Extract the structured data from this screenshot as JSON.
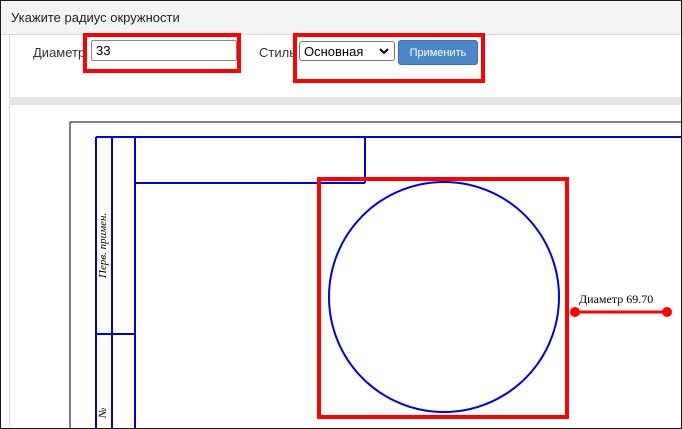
{
  "window": {
    "title": "Укажите радиус окружности"
  },
  "toolbar": {
    "diameter_label": "Диаметр",
    "diameter_value": "33",
    "style_label": "Стиль",
    "style_selected": "Основная",
    "apply_label": "Применить"
  },
  "drawing": {
    "stamp_vertical_text": "Перв. примен.",
    "stamp_number_mark": "№",
    "dimension_label": "Диаметр 69.70",
    "circle_color": "#0000dd",
    "highlight_color": "#ff0000"
  }
}
